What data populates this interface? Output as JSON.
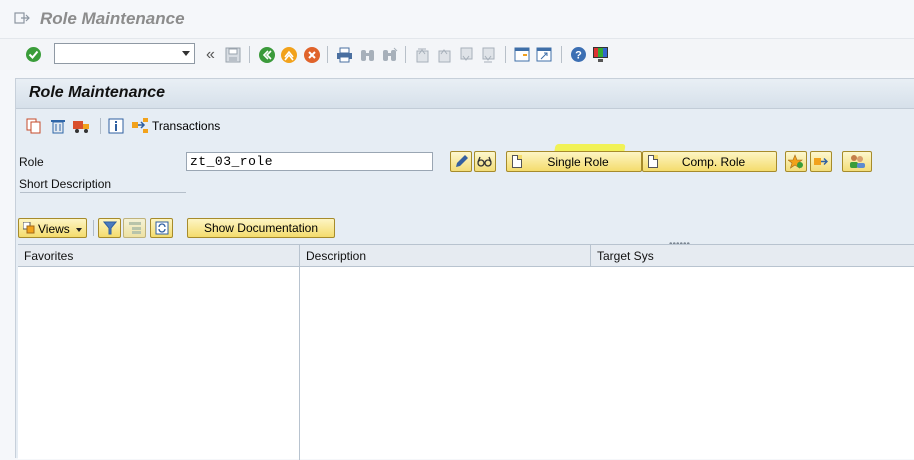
{
  "window": {
    "title": "Role Maintenance"
  },
  "command_field": {
    "value": ""
  },
  "toolbar": {
    "icons": [
      "enter-icon",
      "back-icon",
      "exit-icon",
      "cancel-icon",
      "save-icon",
      "print-icon",
      "find-icon",
      "find-next-icon",
      "first-page-icon",
      "prev-page-icon",
      "next-page-icon",
      "last-page-icon",
      "new-session-icon",
      "shortcut-icon",
      "help-icon",
      "layout-icon"
    ]
  },
  "main": {
    "header": "Role Maintenance",
    "app_toolbar": {
      "transactions_label": "Transactions"
    },
    "role_label": "Role",
    "role_value": "zt_03_role",
    "short_description_label": "Short Description",
    "single_role_button": "Single Role",
    "comp_role_button": "Comp. Role",
    "views_button": "Views",
    "show_documentation_button": "Show Documentation",
    "grid": {
      "columns": [
        "Favorites",
        "Description",
        "Target Sys"
      ]
    }
  },
  "colors": {
    "button_yellow": "#f4dc6d",
    "highlight": "#f2f23a",
    "header_blue": "#d6e0ea"
  }
}
